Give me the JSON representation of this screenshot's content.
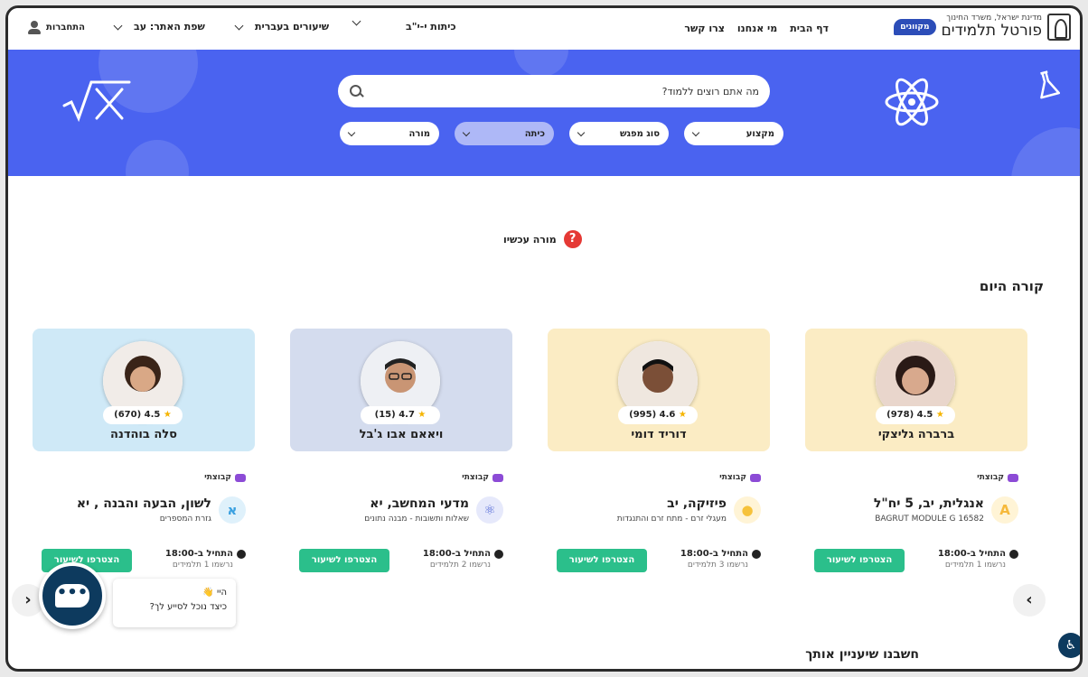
{
  "brand": {
    "subtitle": "מדינת ישראל, משרד החינוך",
    "title": "פורטל תלמידים",
    "pill": "מקוונים"
  },
  "nav": {
    "links": [
      "דף הבית",
      "מי אנחנו",
      "צרו קשר"
    ]
  },
  "topbar": {
    "grades": "כיתות י-י\"ב",
    "lessons": "שיעורים בעברית",
    "language": "שפת האתר: עב",
    "login": "התחברות"
  },
  "search": {
    "placeholder": "מה אתם רוצים ללמוד?"
  },
  "filters": [
    {
      "label": "מקצוע"
    },
    {
      "label": "סוג מפגש"
    },
    {
      "label": "כיתה"
    },
    {
      "label": "מורה"
    }
  ],
  "teacher_now": "מורה עכשיו",
  "section_today": "קורה היום",
  "section_interest": "חשבנו שיעניין אותך",
  "cards": [
    {
      "name": "ברברה גליצקי",
      "rating": "4.5",
      "count": "(978)",
      "badge": "קבוצתי",
      "subject": "אנגלית, יב, 5 יח\"ל",
      "detail": "BAGRUT MODULE G 16582",
      "start": "התחיל ב-18:00",
      "enrolled": "נרשמו 1 תלמידים",
      "join": "הצטרפו לשיעור",
      "color": "#fbecc4",
      "icon_color": "#f6b93b"
    },
    {
      "name": "דוריד דומי",
      "rating": "4.6",
      "count": "(995)",
      "badge": "קבוצתי",
      "subject": "פיזיקה, יב",
      "detail": "מעגלי זרם - מתח זרם והתנגדות",
      "start": "התחיל ב-18:00",
      "enrolled": "נרשמו 3 תלמידים",
      "join": "הצטרפו לשיעור",
      "color": "#fbecc4",
      "icon_color": "#f6c23b"
    },
    {
      "name": "ויאאם אבו ג'בל",
      "rating": "4.7",
      "count": "(15)",
      "badge": "קבוצתי",
      "subject": "מדעי המחשב, יא",
      "detail": "שאלות ותשובות - מבנה נתונים",
      "start": "התחיל ב-18:00",
      "enrolled": "נרשמו 2 תלמידים",
      "join": "הצטרפו לשיעור",
      "color": "#d4dcee",
      "icon_color": "#5a6fd8"
    },
    {
      "name": "סלה בוהדנה",
      "rating": "4.5",
      "count": "(670)",
      "badge": "קבוצתי",
      "subject": "לשון, הבעה והבנה , יא",
      "detail": "גזרת המספרים",
      "start": "התחיל ב-18:00",
      "enrolled": "נרשמו 1 תלמידים",
      "join": "הצטרפו לשיעור",
      "color": "#cfe9f7",
      "icon_color": "#3aa0e0"
    }
  ],
  "chat": {
    "line1": "היי 👋",
    "line2": "כיצד נוכל לסייע לך?"
  }
}
